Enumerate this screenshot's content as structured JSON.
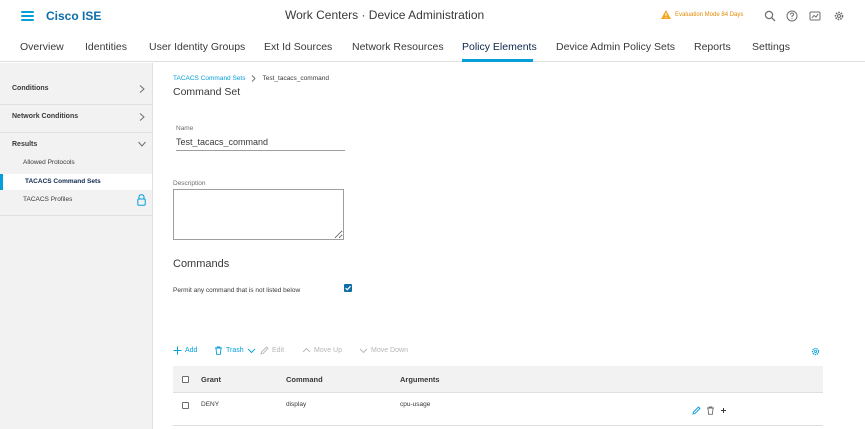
{
  "header": {
    "brand": "Cisco ISE",
    "title": "Work Centers · Device Administration",
    "evaluation": "Evaluation Mode 84 Days",
    "accent_color": "#049fd9",
    "warning_color": "#e08a00"
  },
  "tabs": [
    {
      "label": "Overview"
    },
    {
      "label": "Identities"
    },
    {
      "label": "User Identity Groups"
    },
    {
      "label": "Ext Id Sources"
    },
    {
      "label": "Network Resources"
    },
    {
      "label": "Policy Elements",
      "active": true
    },
    {
      "label": "Device Admin Policy Sets"
    },
    {
      "label": "Reports"
    },
    {
      "label": "Settings"
    }
  ],
  "sidebar": {
    "sections": [
      {
        "label": "Conditions"
      },
      {
        "label": "Network Conditions"
      },
      {
        "label": "Results"
      }
    ],
    "items": [
      {
        "label": "Allowed Protocols"
      },
      {
        "label": "TACACS Command Sets",
        "active": true
      },
      {
        "label": "TACACS Profiles"
      }
    ]
  },
  "breadcrumb": {
    "parent": "TACACS Command Sets",
    "current": "Test_tacacs_command"
  },
  "form": {
    "title": "Command Set",
    "name_label": "Name",
    "name_value": "Test_tacacs_command",
    "description_label": "Description",
    "description_value": ""
  },
  "commands": {
    "heading": "Commands",
    "permit_label": "Permit any command that is not listed below",
    "permit_checked": true
  },
  "toolbar": {
    "add": "Add",
    "trash": "Trash",
    "edit": "Edit",
    "move_up": "Move Up",
    "move_down": "Move Down"
  },
  "table": {
    "columns": [
      "Grant",
      "Command",
      "Arguments"
    ],
    "rows": [
      {
        "grant": "DENY",
        "command": "display",
        "arguments": "cpu-usage"
      }
    ]
  }
}
